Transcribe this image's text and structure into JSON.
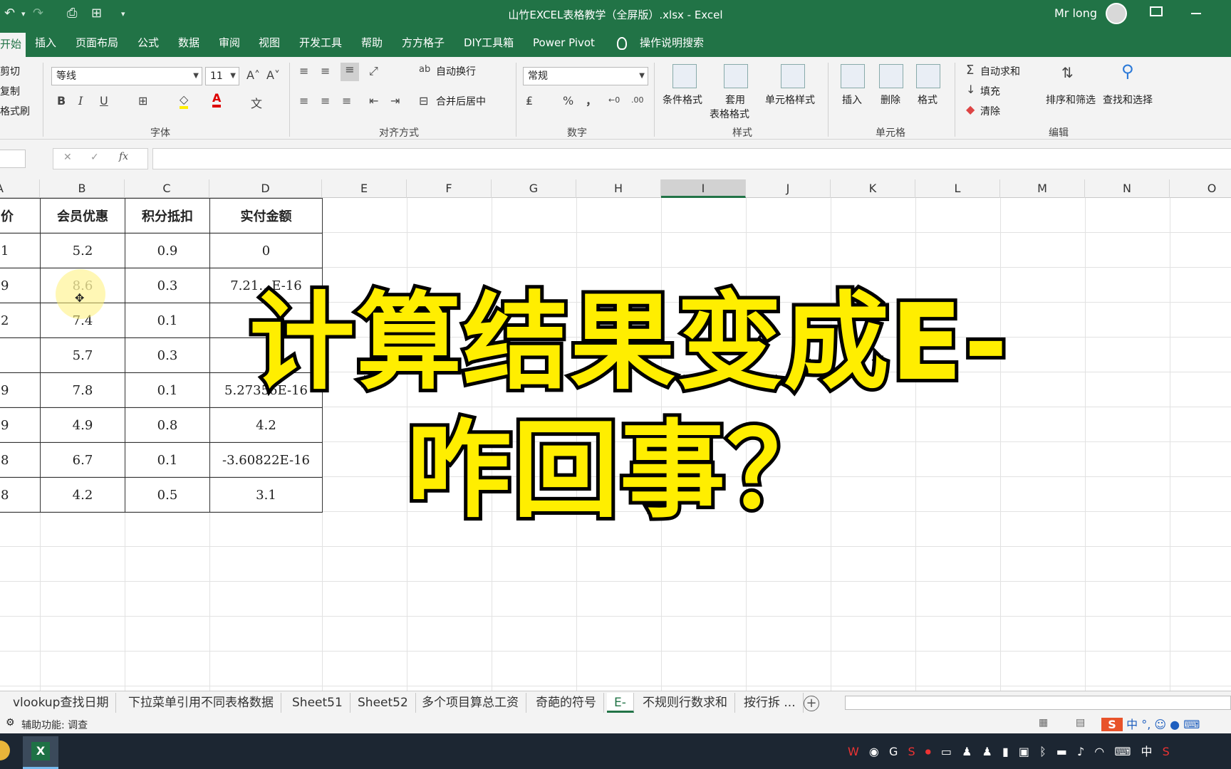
{
  "window": {
    "title": "山竹EXCEL表格教学（全屏版）.xlsx - Excel",
    "user": "Mr long"
  },
  "menu_tabs": [
    "开始",
    "插入",
    "页面布局",
    "公式",
    "数据",
    "审阅",
    "视图",
    "开发工具",
    "帮助",
    "方方格子",
    "DIY工具箱",
    "Power Pivot"
  ],
  "tell_me": "操作说明搜索",
  "ribbon": {
    "clipboard": {
      "cut": "剪切",
      "copy": "复制",
      "format_painter": "格式刷"
    },
    "font": {
      "name": "等线",
      "size": "11",
      "group_label": "字体",
      "bold": "B",
      "italic": "I",
      "underline": "U"
    },
    "alignment": {
      "wrap_text": "自动换行",
      "merge_center": "合并后居中",
      "group_label": "对齐方式"
    },
    "number": {
      "format": "常规",
      "group_label": "数字",
      "percent": "%",
      "comma": "，"
    },
    "styles": {
      "conditional": "条件格式",
      "table_format_1": "套用",
      "table_format_2": "表格格式",
      "cell_styles": "单元格样式",
      "group_label": "样式"
    },
    "cells": {
      "insert": "插入",
      "delete": "删除",
      "format": "格式",
      "group_label": "单元格"
    },
    "editing": {
      "autosum": "自动求和",
      "fill": "填充",
      "clear": "清除",
      "sort_filter": "排序和筛选",
      "find_select": "查找和选择",
      "group_label": "编辑"
    }
  },
  "formula_bar": {
    "fx": "fx",
    "value": ""
  },
  "columns": [
    "A",
    "B",
    "C",
    "D",
    "E",
    "F",
    "G",
    "H",
    "I",
    "J",
    "K",
    "L",
    "M",
    "N",
    "O"
  ],
  "selected_column": "I",
  "table": {
    "headers": [
      "价",
      "会员优惠",
      "积分抵扣",
      "实付金额"
    ],
    "rows": [
      [
        "1",
        "5.2",
        "0.9",
        "0"
      ],
      [
        "9",
        "8.6",
        "0.3",
        "7.21…E-16"
      ],
      [
        "2",
        "7.4",
        "0.1",
        ""
      ],
      [
        "",
        "5.7",
        "0.3",
        ""
      ],
      [
        "9",
        "7.8",
        "0.1",
        "5.27356E-16"
      ],
      [
        "9",
        "4.9",
        "0.8",
        "4.2"
      ],
      [
        "8",
        "6.7",
        "0.1",
        "-3.60822E-16"
      ],
      [
        "8",
        "4.2",
        "0.5",
        "3.1"
      ]
    ]
  },
  "overlay_caption": {
    "line1": "计算结果变成E-",
    "line2": "咋回事？"
  },
  "sheet_tabs": [
    "vlookup查找日期",
    "下拉菜单引用不同表格数据",
    "Sheet51",
    "Sheet52",
    "多个项目算总工资",
    "奇葩的符号",
    "E-",
    "不规则行数求和",
    "按行拆 ..."
  ],
  "active_sheet": "E-",
  "status": {
    "accessibility": "辅助功能: 调查"
  },
  "ime": {
    "mode": "中",
    "punct": "°,",
    "tray_lang": "中"
  },
  "colors": {
    "excel_green": "#217346",
    "caption_yellow": "#ffee00"
  }
}
